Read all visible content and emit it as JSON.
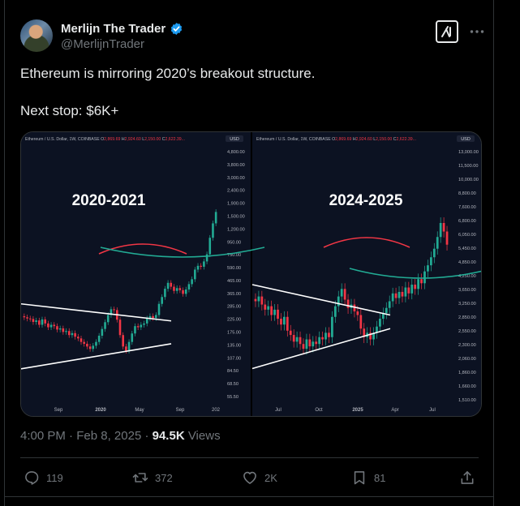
{
  "author": {
    "display_name": "Merlijn The Trader",
    "handle": "@MerlijnTrader",
    "verified": true
  },
  "tweet": {
    "text_line1": "Ethereum is mirroring 2020’s breakout structure.",
    "text_line2": "Next stop: $6K+"
  },
  "meta": {
    "time": "4:00 PM",
    "date": "Feb 8, 2025",
    "views_count": "94.5K",
    "views_label": "Views"
  },
  "actions": {
    "replies": "119",
    "reposts": "372",
    "likes": "2K",
    "bookmarks": "81"
  },
  "chart_common": {
    "symbol_header": "Ethereum / U.S. Dollar, 1W, COINBASE",
    "ohlc": {
      "o_label": "O",
      "o_value": "2,869.69",
      "h_label": "H",
      "h_value": "2,924.60",
      "l_label": "L",
      "l_value": "2,150.00",
      "c_label": "C",
      "c_value": "2,622.39..."
    },
    "currency": "USD"
  },
  "chart_data": [
    {
      "type": "candlestick",
      "title": "2020-2021",
      "y_scale": "log",
      "ylim": [
        55.5,
        4800
      ],
      "y_ticks": [
        "4,800.00",
        "3,800.00",
        "3,000.00",
        "2,400.00",
        "1,900.00",
        "1,500.00",
        "1,200.00",
        "950.00",
        "750.00",
        "590.00",
        "465.00",
        "365.00",
        "285.00",
        "225.00",
        "175.00",
        "135.00",
        "107.00",
        "84.50",
        "68.50",
        "55.50"
      ],
      "x_ticks": [
        "Sep",
        "2020",
        "May",
        "Sep",
        "202"
      ],
      "shape": {
        "kind": "symmetrical triangle",
        "upper_line": {
          "from": 300,
          "to": 220
        },
        "lower_line": {
          "from": 92,
          "to": 145
        }
      },
      "closes": [
        235,
        230,
        228,
        216,
        222,
        205,
        226,
        210,
        196,
        205,
        200,
        188,
        192,
        180,
        183,
        170,
        176,
        165,
        160,
        150,
        145,
        138,
        132,
        140,
        150,
        168,
        190,
        215,
        245,
        272,
        268,
        225,
        170,
        138,
        128,
        150,
        175,
        200,
        196,
        205,
        210,
        230,
        240,
        232,
        245,
        300,
        340,
        395,
        440,
        410,
        380,
        400,
        385,
        360,
        390,
        430,
        470,
        560,
        600,
        590,
        650,
        740,
        1000,
        1300,
        1600
      ]
    },
    {
      "type": "candlestick",
      "title": "2024-2025",
      "y_scale": "log",
      "ylim": [
        1510,
        13000
      ],
      "y_ticks": [
        "13,000.00",
        "11,500.00",
        "10,000.00",
        "8,800.00",
        "7,600.00",
        "6,800.00",
        "6,050.00",
        "5,450.00",
        "4,850.00",
        "4,250.00",
        "3,650.00",
        "3,250.00",
        "2,850.00",
        "2,550.00",
        "2,300.00",
        "2,060.00",
        "1,860.00",
        "1,660.00",
        "1,510.00"
      ],
      "x_ticks": [
        "Jul",
        "Oct",
        "2025",
        "Apr",
        "Jul"
      ],
      "shape": {
        "kind": "symmetrical triangle",
        "upper_line": {
          "from": 4100,
          "to": 3150
        },
        "lower_line": {
          "from": 1980,
          "to": 2800
        }
      },
      "closes": [
        3550,
        3700,
        3450,
        3300,
        3400,
        3150,
        3300,
        3050,
        2900,
        3100,
        2750,
        2650,
        2500,
        2600,
        2450,
        2350,
        2550,
        2400,
        2500,
        2450,
        2600,
        2550,
        2700,
        2600,
        3100,
        3400,
        3700,
        3950,
        3600,
        3350,
        3450,
        3250,
        3150,
        2800,
        2600,
        2700,
        2550,
        2700,
        2850,
        3050,
        3200,
        3350,
        3550,
        3800,
        3650,
        3850,
        3700,
        4000,
        3800,
        4100,
        3950,
        4300,
        4150,
        4600,
        4850,
        5200,
        5600,
        6200,
        7000,
        6500,
        5800
      ]
    }
  ]
}
